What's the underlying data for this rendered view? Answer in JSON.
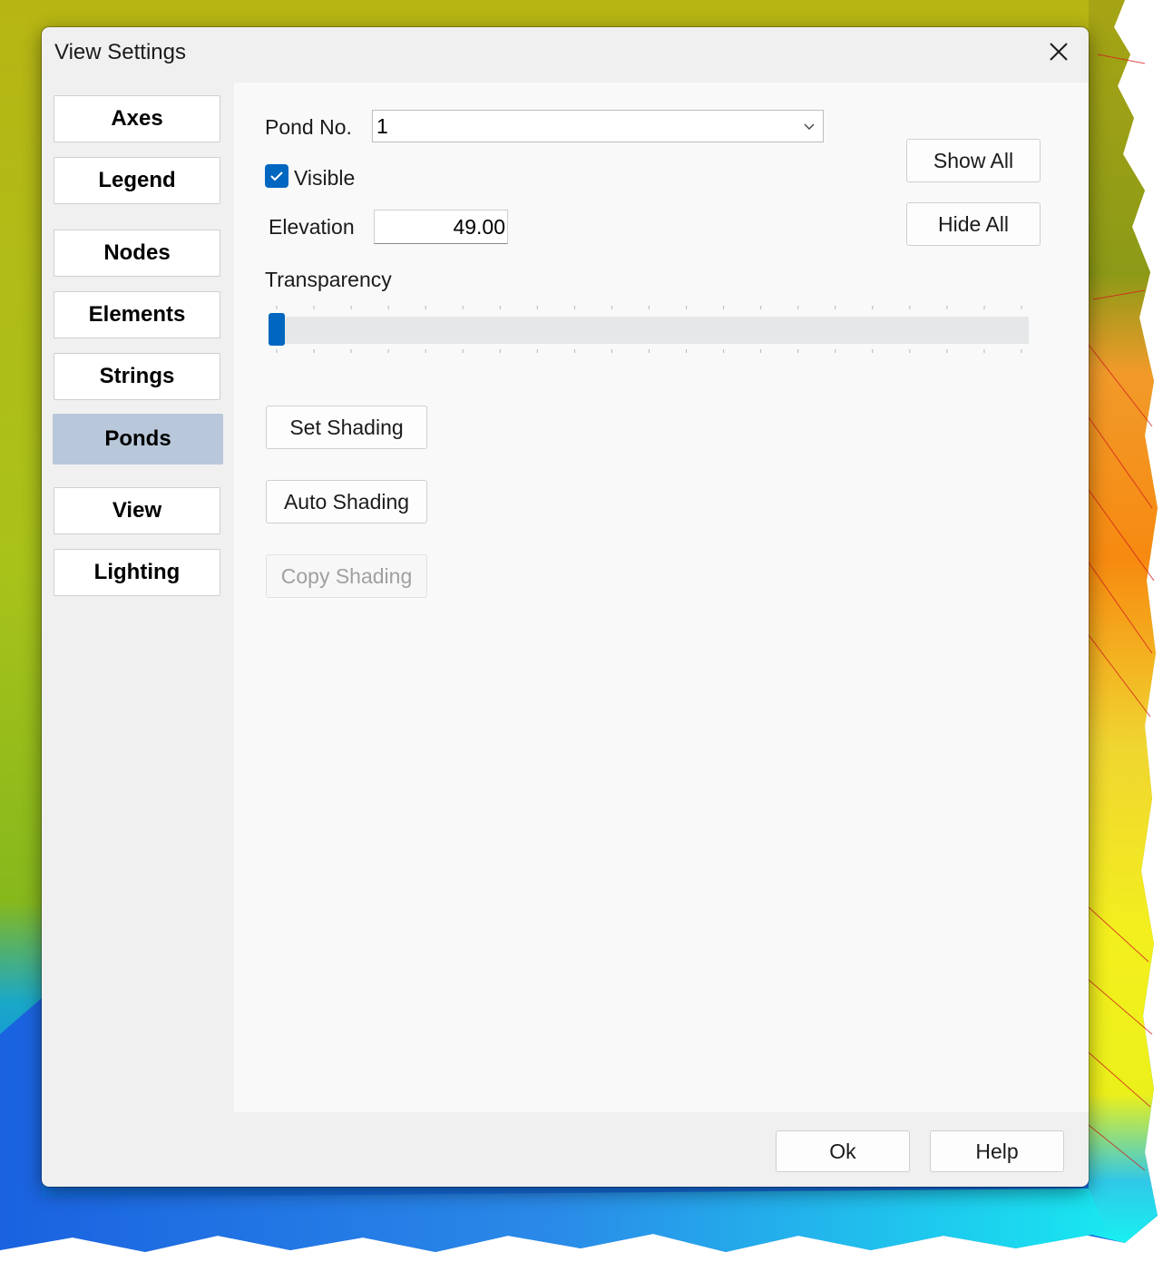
{
  "window": {
    "title": "View Settings"
  },
  "sidebar": {
    "items": [
      {
        "label": "Axes",
        "active": false
      },
      {
        "label": "Legend",
        "active": false
      },
      {
        "label": "Nodes",
        "active": false
      },
      {
        "label": "Elements",
        "active": false
      },
      {
        "label": "Strings",
        "active": false
      },
      {
        "label": "Ponds",
        "active": true
      },
      {
        "label": "View",
        "active": false
      },
      {
        "label": "Lighting",
        "active": false
      }
    ]
  },
  "ponds": {
    "pond_no_label": "Pond No.",
    "pond_no_value": "1",
    "visible_label": "Visible",
    "visible_checked": true,
    "elevation_label": "Elevation",
    "elevation_value": "49.00",
    "transparency_label": "Transparency",
    "transparency_value": 0,
    "show_all_label": "Show All",
    "hide_all_label": "Hide All",
    "set_shading_label": "Set Shading",
    "auto_shading_label": "Auto Shading",
    "copy_shading_label": "Copy Shading"
  },
  "footer": {
    "ok_label": "Ok",
    "help_label": "Help"
  },
  "colors": {
    "accent": "#0067c0",
    "active_nav": "#b8c7d9"
  },
  "icons": {
    "close": "close-icon",
    "dropdown": "chevron-down-icon",
    "check": "checkmark-icon"
  }
}
